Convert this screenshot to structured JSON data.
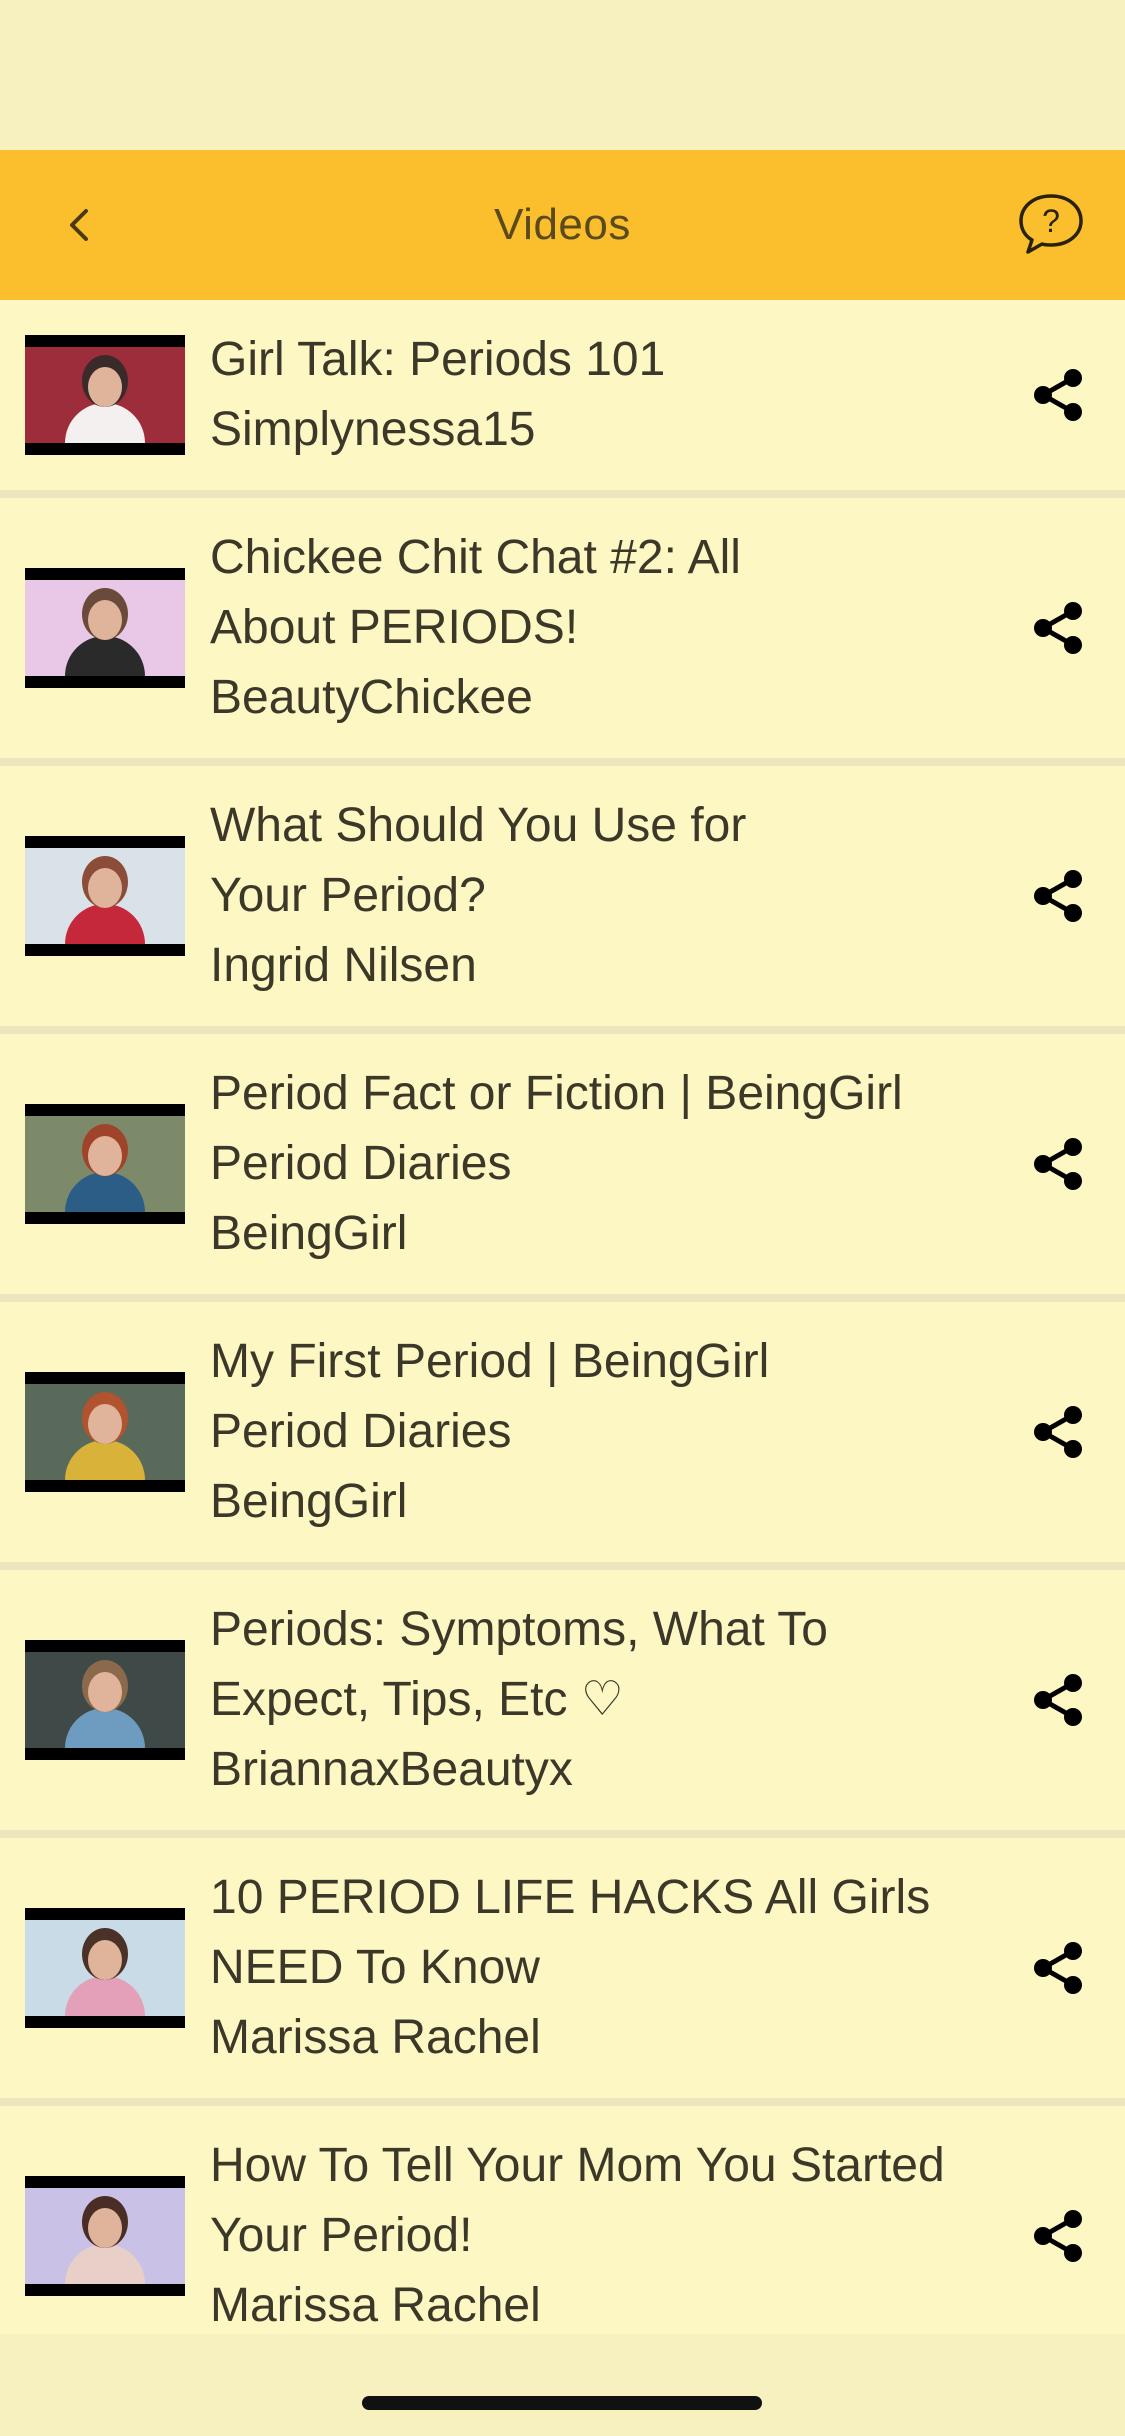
{
  "header": {
    "title": "Videos",
    "back_icon": "chevron-left-icon",
    "help_icon": "help-bubble-icon",
    "background_color": "#fbbf2e"
  },
  "videos": [
    {
      "title_lines": [
        "Girl Talk: Periods 101"
      ],
      "channel": "Simplynessa15",
      "thumb_colors": [
        "#9e2d3c",
        "#3b2a2a",
        "#f5f0f0"
      ]
    },
    {
      "title_lines": [
        "Chickee Chit Chat #2: All",
        "About PERIODS!"
      ],
      "channel": "BeautyChickee",
      "thumb_colors": [
        "#e9c7e6",
        "#6a4a3a",
        "#2a2a2a"
      ]
    },
    {
      "title_lines": [
        "What Should You Use for",
        "Your Period?"
      ],
      "channel": "Ingrid Nilsen",
      "thumb_colors": [
        "#d8e2e8",
        "#8b4c3a",
        "#c5283a"
      ]
    },
    {
      "title_lines": [
        "Period Fact or Fiction | BeingGirl",
        "Period Diaries"
      ],
      "channel": "BeingGirl",
      "thumb_colors": [
        "#7d8a6a",
        "#a0432b",
        "#2c5d86"
      ]
    },
    {
      "title_lines": [
        "My First Period | BeingGirl",
        "Period Diaries"
      ],
      "channel": "BeingGirl",
      "thumb_colors": [
        "#5a6a5a",
        "#b0532e",
        "#d9b23a"
      ]
    },
    {
      "title_lines": [
        "Periods: Symptoms, What To",
        "Expect, Tips, Etc ♡"
      ],
      "channel": "BriannaxBeautyx",
      "thumb_colors": [
        "#3f4a48",
        "#8a6a4a",
        "#6e9bc0"
      ]
    },
    {
      "title_lines": [
        "10 PERIOD LIFE HACKS All Girls",
        "NEED To Know"
      ],
      "channel": "Marissa Rachel",
      "thumb_colors": [
        "#c8dbe6",
        "#4a3228",
        "#e4a0b8"
      ]
    },
    {
      "title_lines": [
        "How To Tell Your Mom You Started",
        "Your Period!"
      ],
      "channel": "Marissa Rachel",
      "thumb_colors": [
        "#c9c2e6",
        "#4a2e26",
        "#e8d0c8"
      ]
    }
  ],
  "share_icon": "share-icon"
}
